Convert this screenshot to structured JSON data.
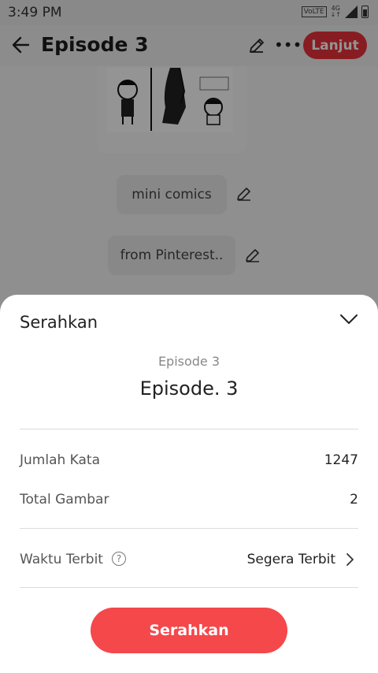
{
  "status_bar": {
    "time": "3:49 PM",
    "volte": "VoLTE",
    "network": "4G"
  },
  "app_bar": {
    "title": "Episode 3",
    "next_button": "Lanjut"
  },
  "content": {
    "chips": [
      {
        "label": "mini comics"
      },
      {
        "label": "from Pinterest.."
      }
    ]
  },
  "sheet": {
    "title": "Serahkan",
    "episode_subtitle": "Episode 3",
    "episode_title": "Episode. 3",
    "stats": [
      {
        "label": "Jumlah Kata",
        "value": "1247"
      },
      {
        "label": "Total Gambar",
        "value": "2"
      }
    ],
    "publish": {
      "label": "Waktu Terbit",
      "help": "?",
      "value": "Segera Terbit"
    },
    "submit_button": "Serahkan"
  },
  "colors": {
    "accent": "#f4484b",
    "overlay": "rgba(0,0,0,0.42)"
  }
}
